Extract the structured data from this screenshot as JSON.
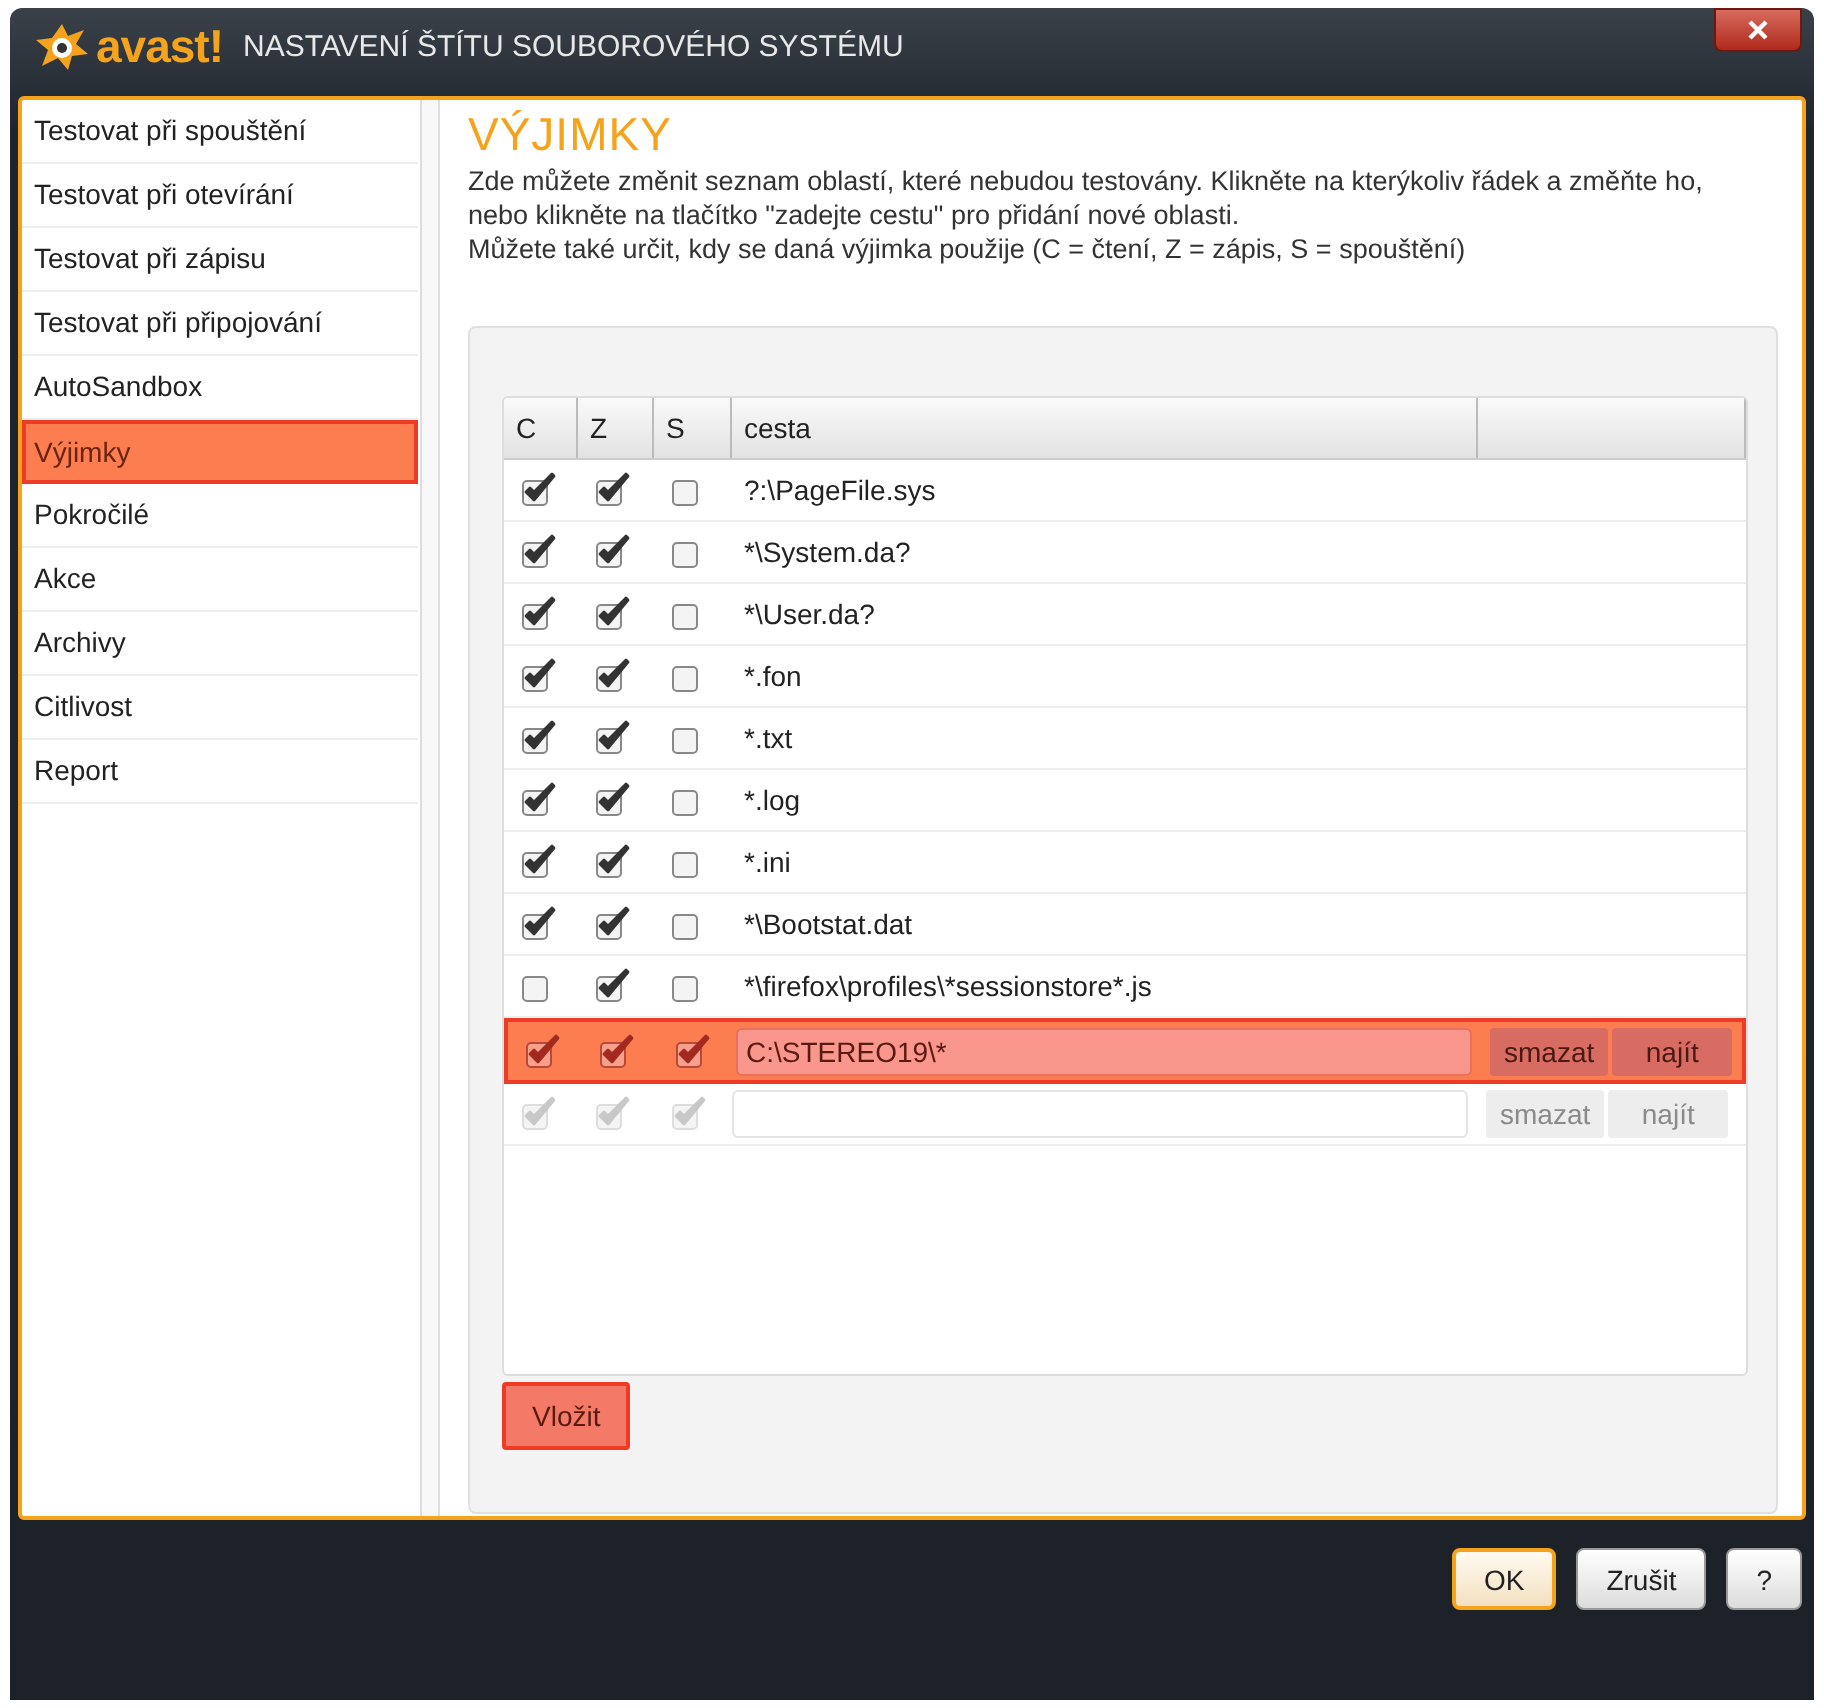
{
  "window": {
    "logo": "avast!",
    "title": "NASTAVENÍ ŠTÍTU SOUBOROVÉHO SYSTÉMU"
  },
  "sidebar": {
    "items": [
      {
        "label": "Testovat při spouštění",
        "selected": false
      },
      {
        "label": "Testovat při otevírání",
        "selected": false
      },
      {
        "label": "Testovat při zápisu",
        "selected": false
      },
      {
        "label": "Testovat při připojování",
        "selected": false
      },
      {
        "label": "AutoSandbox",
        "selected": false
      },
      {
        "label": "Výjimky",
        "selected": true
      },
      {
        "label": "Pokročilé",
        "selected": false
      },
      {
        "label": "Akce",
        "selected": false
      },
      {
        "label": "Archivy",
        "selected": false
      },
      {
        "label": "Citlivost",
        "selected": false
      },
      {
        "label": "Report",
        "selected": false
      }
    ]
  },
  "heading": "VÝJIMKY",
  "description": [
    "Zde můžete změnit seznam oblastí, které nebudou testovány. Klikněte na kterýkoliv řádek a změňte ho, nebo klikněte na tlačítko \"zadejte cestu\" pro přidání nové oblasti.",
    "Můžete také určit, kdy se daná výjimka použije (C = čtení, Z = zápis, S = spouštění)"
  ],
  "table": {
    "columns": [
      "C",
      "Z",
      "S",
      "cesta"
    ],
    "rows": [
      {
        "kind": "entry",
        "c": true,
        "z": true,
        "s": false,
        "path": "?:\\PageFile.sys"
      },
      {
        "kind": "entry",
        "c": true,
        "z": true,
        "s": false,
        "path": "*\\System.da?"
      },
      {
        "kind": "entry",
        "c": true,
        "z": true,
        "s": false,
        "path": "*\\User.da?"
      },
      {
        "kind": "entry",
        "c": true,
        "z": true,
        "s": false,
        "path": "*.fon"
      },
      {
        "kind": "entry",
        "c": true,
        "z": true,
        "s": false,
        "path": "*.txt"
      },
      {
        "kind": "entry",
        "c": true,
        "z": true,
        "s": false,
        "path": "*.log"
      },
      {
        "kind": "entry",
        "c": true,
        "z": true,
        "s": false,
        "path": "*.ini"
      },
      {
        "kind": "entry",
        "c": true,
        "z": true,
        "s": false,
        "path": "*\\Bootstat.dat"
      },
      {
        "kind": "entry",
        "c": false,
        "z": true,
        "s": false,
        "path": "*\\firefox\\profiles\\*sessionstore*.js"
      },
      {
        "kind": "edit",
        "selected": true,
        "disabled": false,
        "c": true,
        "z": true,
        "s": true,
        "path": "C:\\STEREO19\\*",
        "delete": "smazat",
        "find": "najít"
      },
      {
        "kind": "edit",
        "selected": false,
        "disabled": true,
        "c": true,
        "z": true,
        "s": true,
        "delete": "smazat",
        "find": "najít"
      }
    ]
  },
  "add_button": {
    "label": "Vložit",
    "highlighted": true
  },
  "footer": {
    "buttons": [
      {
        "label": "OK",
        "default": true
      },
      {
        "label": "Zrušit",
        "default": false
      },
      {
        "label": "?",
        "default": false
      }
    ]
  }
}
